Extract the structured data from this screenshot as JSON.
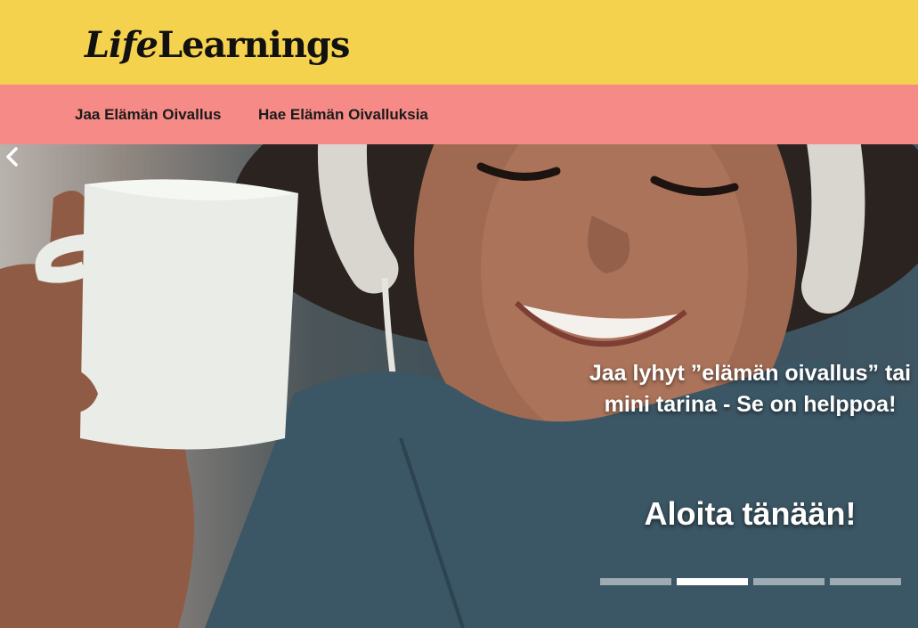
{
  "header": {
    "logo_part1": "Life",
    "logo_part2": "Learnings",
    "background_color": "#f4d24e"
  },
  "nav": {
    "background_color": "#f58a86",
    "items": [
      {
        "label": "Jaa Elämän Oivallus"
      },
      {
        "label": "Hae Elämän Oivalluksia"
      }
    ]
  },
  "carousel": {
    "caption": "Jaa lyhyt ”elämän oivallus” tai mini tarina - Se on helppoa!",
    "cta": "Aloita tänään!",
    "prev_icon": "chevron-left-icon",
    "slide_count": 4,
    "active_index": 1
  }
}
